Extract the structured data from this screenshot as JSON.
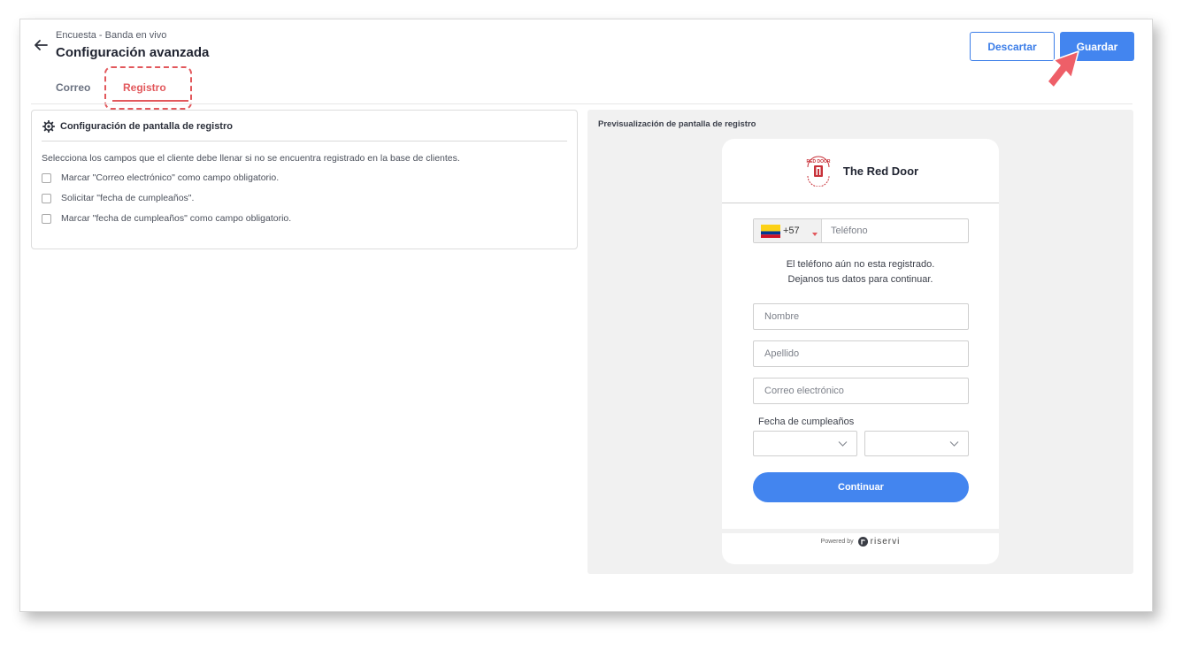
{
  "header": {
    "breadcrumb": "Encuesta - Banda en vivo",
    "title": "Configuración avanzada",
    "discard_label": "Descartar",
    "save_label": "Guardar"
  },
  "tabs": [
    {
      "label": "Correo",
      "active": false
    },
    {
      "label": "Registro",
      "active": true
    }
  ],
  "config": {
    "title": "Configuración de pantalla de registro",
    "description": "Selecciona los campos que el cliente debe llenar si no se encuentra registrado en la base de clientes.",
    "options": [
      {
        "label": "Marcar \"Correo electrónico\" como campo obligatorio.",
        "checked": false
      },
      {
        "label": "Solicitar \"fecha de cumpleaños\".",
        "checked": false
      },
      {
        "label": "Marcar \"fecha de cumpleaños\" como campo obligatorio.",
        "checked": false
      }
    ]
  },
  "preview": {
    "title": "Previsualización de pantalla de registro",
    "brand_name": "The Red Door",
    "logo_text": "RED DOOR",
    "phone_prefix": "+57",
    "phone_placeholder": "Teléfono",
    "notice_line1": "El teléfono aún no esta registrado.",
    "notice_line2": "Dejanos tus datos para continuar.",
    "first_name_placeholder": "Nombre",
    "last_name_placeholder": "Apellido",
    "email_placeholder": "Correo electrónico",
    "birthday_label": "Fecha de cumpleaños",
    "continue_label": "Continuar",
    "powered_by": "Powered by",
    "powered_brand": "riservi"
  },
  "colors": {
    "accent": "#4385ef",
    "highlight": "#e2585c",
    "preview_bg": "#f1f1f1"
  },
  "icons": [
    "back-arrow-icon",
    "gear-icon",
    "colombia-flag-icon",
    "chevron-down-icon",
    "red-door-logo",
    "riservi-logo-icon",
    "cursor-arrow-icon"
  ]
}
